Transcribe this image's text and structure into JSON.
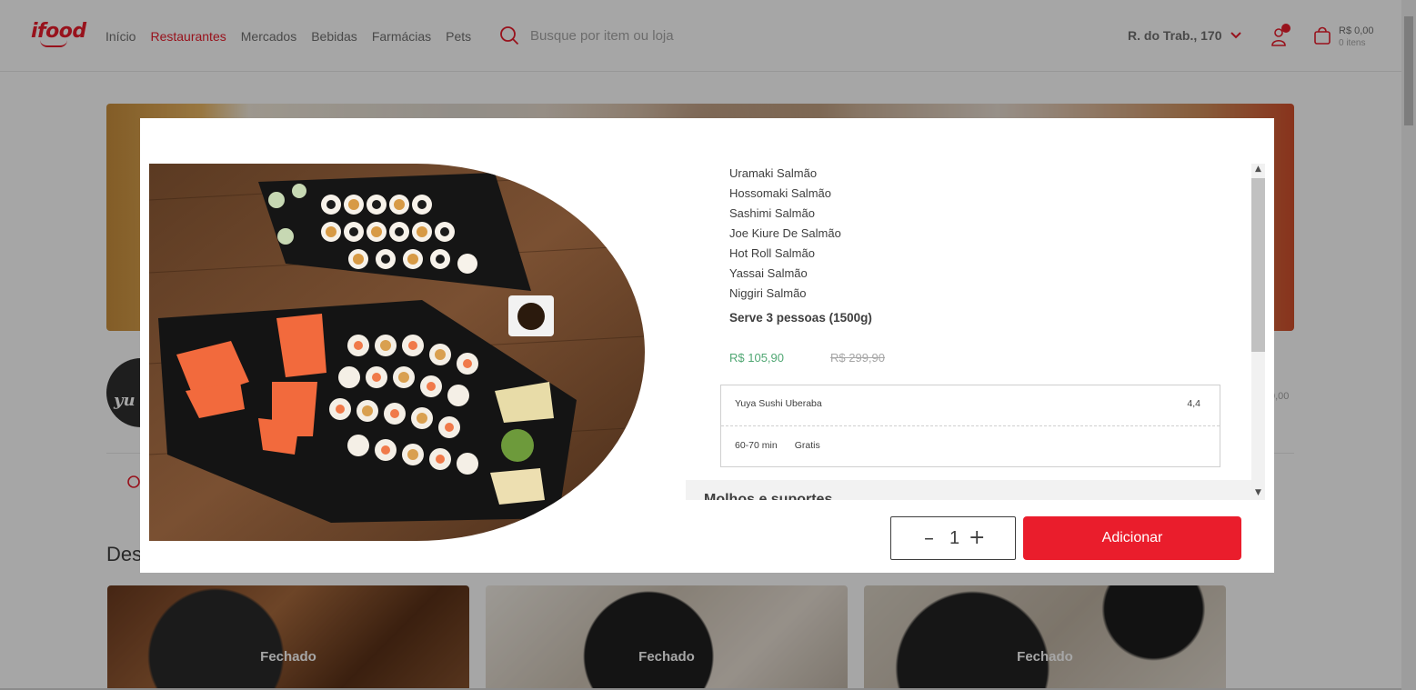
{
  "header": {
    "logo": "ifood",
    "nav": [
      "Início",
      "Restaurantes",
      "Mercados",
      "Bebidas",
      "Farmácias",
      "Pets"
    ],
    "active_nav": "Restaurantes",
    "search_placeholder": "Busque por item ou loja",
    "address": "R. do Trab., 170",
    "cart_total": "R$ 0,00",
    "cart_items": "0 itens"
  },
  "store": {
    "avatar_text": "yu",
    "meta_right": "0,00"
  },
  "section": {
    "title": "Des"
  },
  "cards": [
    {
      "status": "Fechado"
    },
    {
      "status": "Fechado"
    },
    {
      "status": "Fechado"
    }
  ],
  "modal": {
    "items": [
      "Uramaki Salmão",
      "Hossomaki Salmão",
      "Sashimi Salmão",
      "Joe Kiure De Salmão",
      "Hot Roll Salmão",
      "Yassai Salmão",
      "Niggiri Salmão"
    ],
    "serves": "Serve 3 pessoas (1500g)",
    "price": "R$ 105,90",
    "old_price": "R$ 299,90",
    "store_name": "Yuya Sushi Uberaba",
    "store_rating": "4,4",
    "delivery_time": "60-70 min",
    "delivery_fee": "Gratis",
    "section_title": "Molhos e suportes",
    "quantity": "1",
    "minus_label": "–",
    "plus_label": "+",
    "add_label": "Adicionar"
  },
  "colors": {
    "brand": "#ea1d2c",
    "price_green": "#50a773"
  }
}
